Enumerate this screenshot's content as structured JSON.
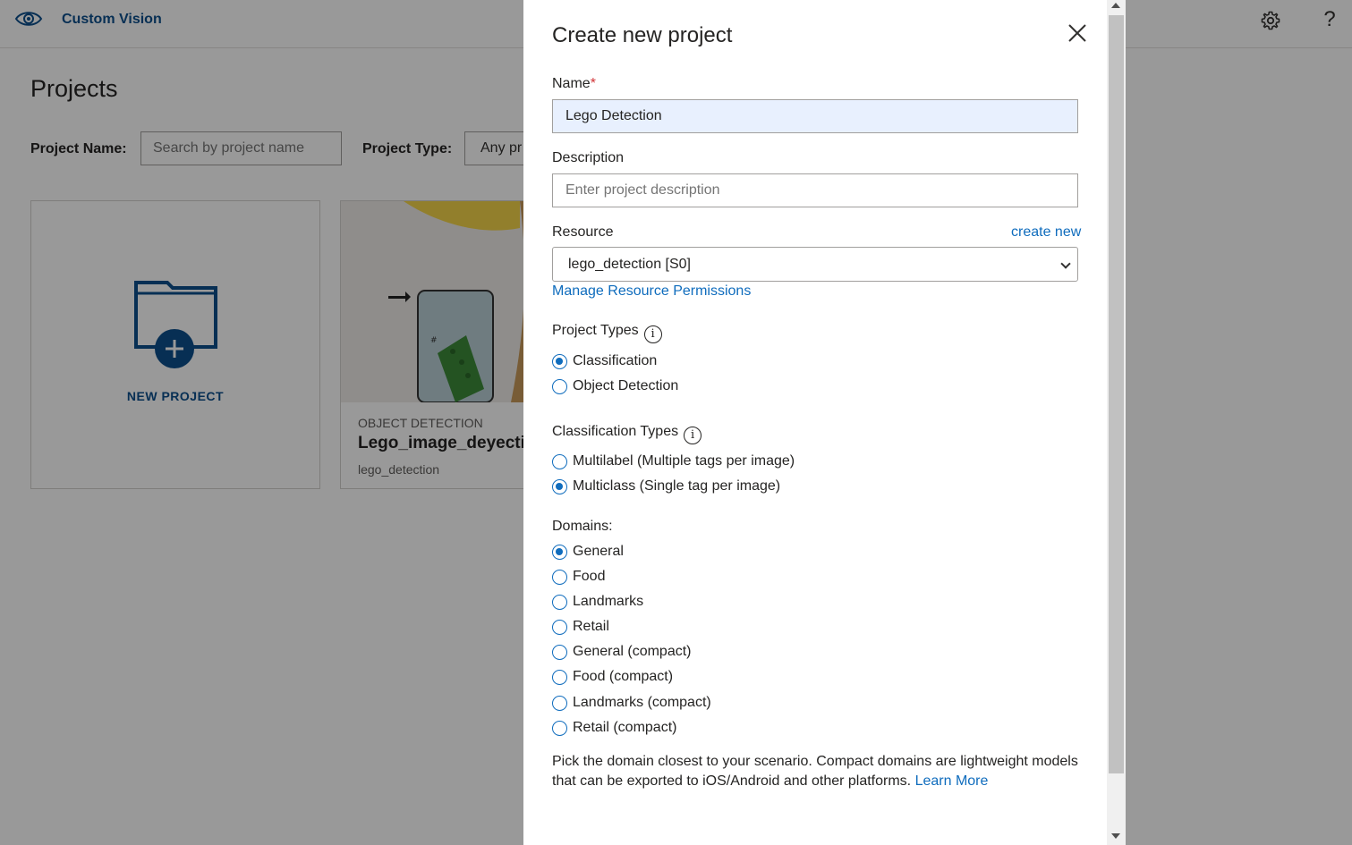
{
  "app": {
    "title": "Custom Vision",
    "page_title": "Projects",
    "filters": {
      "project_name_label": "Project Name:",
      "project_name_placeholder": "Search by project name",
      "project_type_label": "Project Type:",
      "project_type_value": "Any pr"
    },
    "new_project_label": "NEW PROJECT",
    "project_card": {
      "type": "OBJECT DETECTION",
      "name": "Lego_image_deyectio",
      "resource": "lego_detection"
    }
  },
  "dialog": {
    "title": "Create new project",
    "name_label": "Name",
    "required_mark": "*",
    "name_value": "Lego Detection",
    "description_label": "Description",
    "description_placeholder": "Enter project description",
    "resource_label": "Resource",
    "create_new_link": "create new",
    "resource_value": "lego_detection [S0]",
    "manage_permissions_link": "Manage Resource Permissions",
    "project_types_label": "Project Types",
    "project_types": [
      {
        "label": "Classification",
        "selected": true
      },
      {
        "label": "Object Detection",
        "selected": false
      }
    ],
    "classification_types_label": "Classification Types",
    "classification_types": [
      {
        "label": "Multilabel (Multiple tags per image)",
        "selected": false
      },
      {
        "label": "Multiclass (Single tag per image)",
        "selected": true
      }
    ],
    "domains_label": "Domains:",
    "domains": [
      {
        "label": "General",
        "selected": true
      },
      {
        "label": "Food",
        "selected": false
      },
      {
        "label": "Landmarks",
        "selected": false
      },
      {
        "label": "Retail",
        "selected": false
      },
      {
        "label": "General (compact)",
        "selected": false
      },
      {
        "label": "Food (compact)",
        "selected": false
      },
      {
        "label": "Landmarks (compact)",
        "selected": false
      },
      {
        "label": "Retail (compact)",
        "selected": false
      }
    ],
    "help_text": "Pick the domain closest to your scenario. Compact domains are lightweight models that can be exported to iOS/Android and other platforms.",
    "learn_more_link": "Learn More"
  },
  "colors": {
    "accent": "#0f6cbd",
    "brand": "#0d4f8c",
    "required": "#d13438"
  }
}
